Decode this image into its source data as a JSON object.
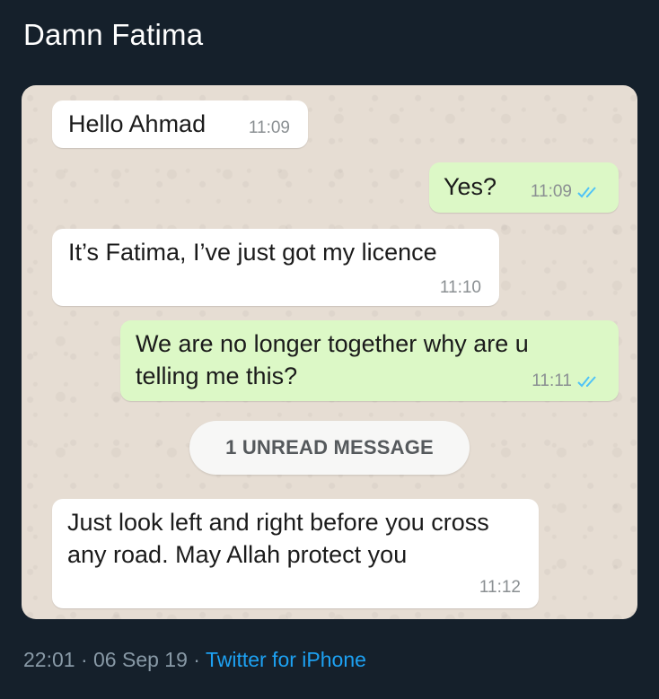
{
  "tweet": {
    "text": "Damn Fatima",
    "time": "22:01",
    "date": "06 Sep 19",
    "separator": "·",
    "source": "Twitter for iPhone"
  },
  "chat": {
    "messages": [
      {
        "direction": "incoming",
        "text": "Hello Ahmad",
        "time": "11:09"
      },
      {
        "direction": "outgoing",
        "text": "Yes?",
        "time": "11:09",
        "status": "read"
      },
      {
        "direction": "incoming",
        "text": "It’s Fatima, I’ve just got my licence",
        "time": "11:10"
      },
      {
        "direction": "outgoing",
        "text": "We are no longer together why are u telling me this?",
        "time": "11:11",
        "status": "read"
      },
      {
        "direction": "incoming",
        "text": "Just look left and right before you cross any road. May Allah protect you",
        "time": "11:12"
      }
    ],
    "unread_label": "1 UNREAD MESSAGE",
    "colors": {
      "incoming": "#ffffff",
      "outgoing": "#dcf8c6",
      "read_ticks": "#4fc3f7",
      "wallpaper": "#e6ddd3"
    }
  }
}
